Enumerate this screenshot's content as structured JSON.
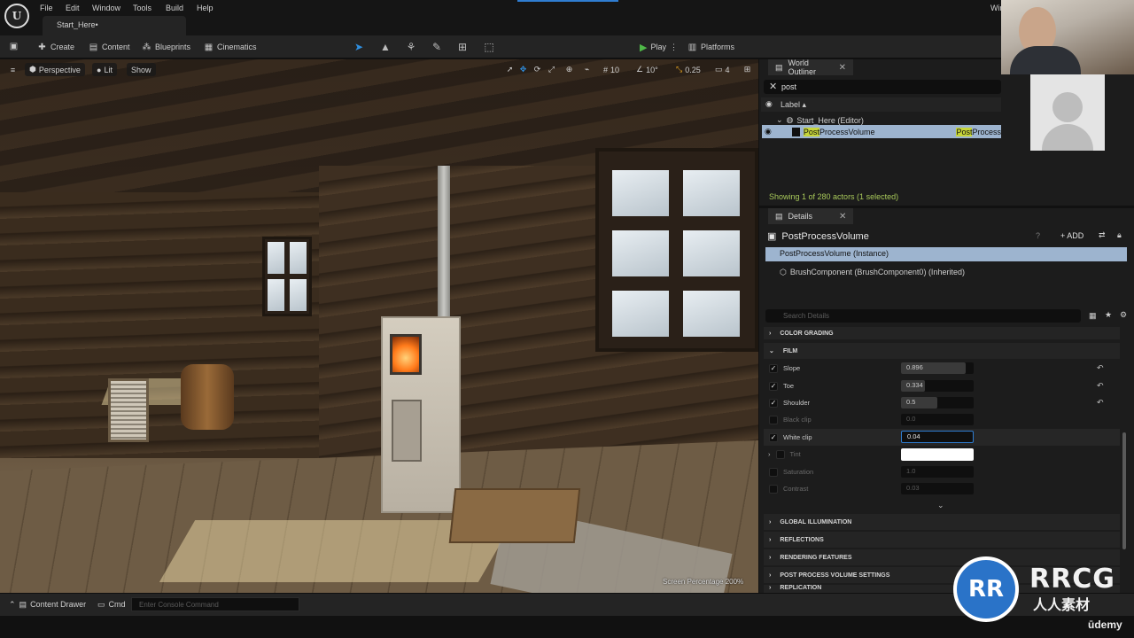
{
  "menu": {
    "items": [
      "File",
      "Edit",
      "Window",
      "Tools",
      "Build",
      "Help"
    ],
    "window_label": "Wir"
  },
  "tab": {
    "title": "Start_Here•"
  },
  "toolbar": {
    "create": "Create",
    "content": "Content",
    "blueprints": "Blueprints",
    "cinematics": "Cinematics",
    "play": "Play",
    "platforms": "Platforms"
  },
  "viewport": {
    "perspective": "Perspective",
    "lit": "Lit",
    "show": "Show",
    "grid_snap": "10",
    "rotate_snap": "10°",
    "scale_snap": "0.25",
    "camera_speed": "4",
    "screen_percentage": "Screen Percentage  200%"
  },
  "outliner": {
    "tab": "World Outliner",
    "search_value": "post",
    "column_label": "Label ▴",
    "world_row": "Start_Here (Editor)",
    "actor_highlight": "Post",
    "actor_rest": "ProcessVolume",
    "type_highlight": "Post",
    "type_rest": "Process",
    "status": "Showing 1 of 280 actors (1 selected)"
  },
  "details": {
    "tab": "Details",
    "title": "PostProcessVolume",
    "add_label": "ADD",
    "instance_row": "PostProcessVolume (Instance)",
    "brush_row": "BrushComponent (BrushComponent0) (Inherited)",
    "search_placeholder": "Search Details",
    "categories": {
      "color_grading": "COLOR GRADING",
      "film": "FILM",
      "global_illumination": "GLOBAL ILLUMINATION",
      "reflections": "REFLECTIONS",
      "rendering_features": "RENDERING FEATURES",
      "post_process_volume_settings": "POST PROCESS VOLUME SETTINGS",
      "replication": "REPLICATION"
    },
    "props": {
      "slope": {
        "label": "Slope",
        "value": "0.896",
        "fill": 0.896
      },
      "toe": {
        "label": "Toe",
        "value": "0.334",
        "fill": 0.334
      },
      "shoulder": {
        "label": "Shoulder",
        "value": "0.5",
        "fill": 0.5
      },
      "black_clip": {
        "label": "Black clip",
        "value": "0.0"
      },
      "white_clip": {
        "label": "White clip",
        "value": "0.04"
      },
      "tint": {
        "label": "Tint"
      },
      "saturation": {
        "label": "Saturation",
        "value": "1.0"
      },
      "contrast": {
        "label": "Contrast",
        "value": "0.03"
      }
    }
  },
  "bottom": {
    "content_drawer": "Content Drawer",
    "cmd": "Cmd",
    "console_placeholder": "Enter Console Command"
  },
  "watermark": {
    "logo": "RR",
    "name": "RRCG",
    "sub": "人人素材",
    "udemy": "ūdemy"
  },
  "colors": {
    "accent": "#2f7dd1",
    "selection": "#9db4cf",
    "highlight": "#c7d63a",
    "play": "#4fb848",
    "status": "#a8c95a"
  }
}
